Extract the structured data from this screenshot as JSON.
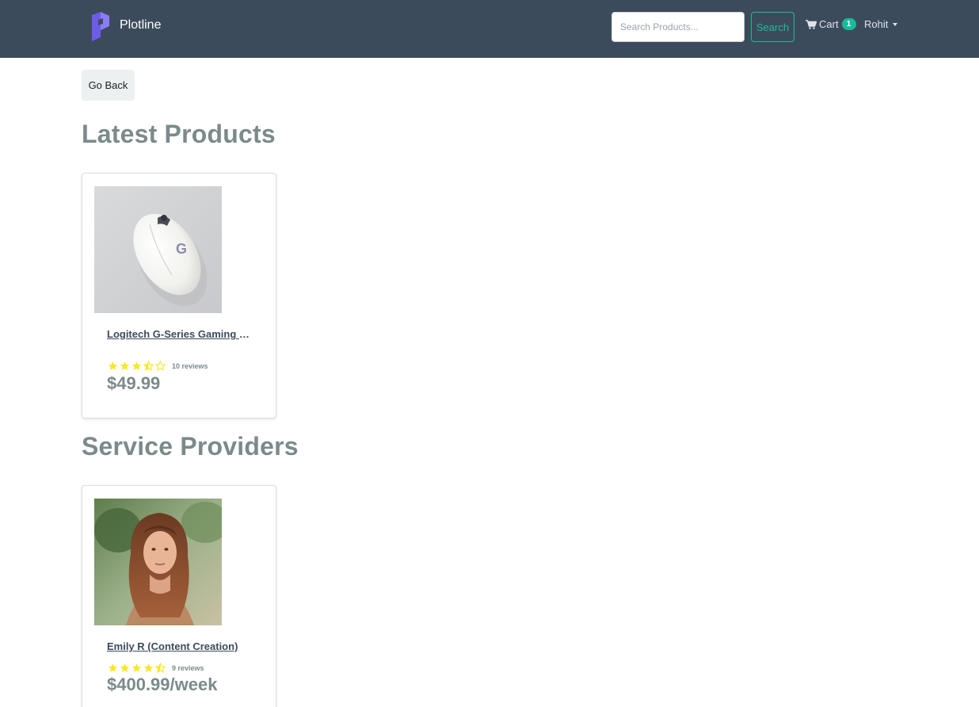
{
  "brand": {
    "name": "Plotline",
    "logo_color": "#6c5ce7"
  },
  "search": {
    "placeholder": "Search Products...",
    "button_label": "Search"
  },
  "cart": {
    "label": "Cart",
    "count": "1"
  },
  "user": {
    "name": "Rohit"
  },
  "go_back_label": "Go Back",
  "sections": {
    "products": {
      "title": "Latest Products",
      "items": [
        {
          "name": "Logitech G-Series Gaming Mouse",
          "reviews": "10 reviews",
          "rating": 3.5,
          "price": "$49.99"
        }
      ]
    },
    "services": {
      "title": "Service Providers",
      "items": [
        {
          "name": "Emily R (Content Creation)",
          "reviews": "9 reviews",
          "rating": 4.5,
          "price": "$400.99/week"
        }
      ]
    }
  },
  "colors": {
    "navbar": "#3c4b5c",
    "accent": "#18bc9c",
    "star": "#f8e825",
    "text_muted": "#7b8a8b"
  }
}
